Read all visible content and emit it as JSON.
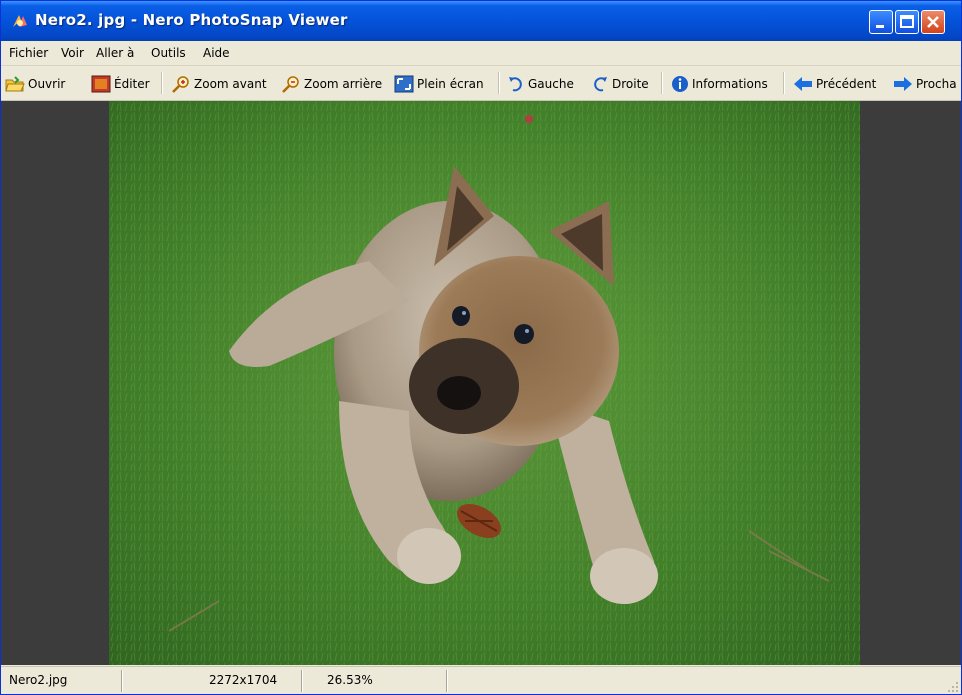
{
  "window": {
    "title": "Nero2. jpg - Nero PhotoSnap Viewer"
  },
  "menu": [
    "Fichier",
    "Voir",
    "Aller à",
    "Outils",
    "Aide"
  ],
  "toolbar": {
    "open": "Ouvrir",
    "edit": "Éditer",
    "zoom_in": "Zoom avant",
    "zoom_out": "Zoom arrière",
    "fullscreen": "Plein écran",
    "rotate_left": "Gauche",
    "rotate_right": "Droite",
    "info": "Informations",
    "previous": "Précédent",
    "next": "Procha"
  },
  "status": {
    "filename": "Nero2.jpg",
    "dimensions": "2272x1704",
    "zoom": "26.53%"
  },
  "colors": {
    "title_bar": "#0453da",
    "viewer_bg": "#3c3c3c",
    "chrome": "#ece9d8"
  }
}
